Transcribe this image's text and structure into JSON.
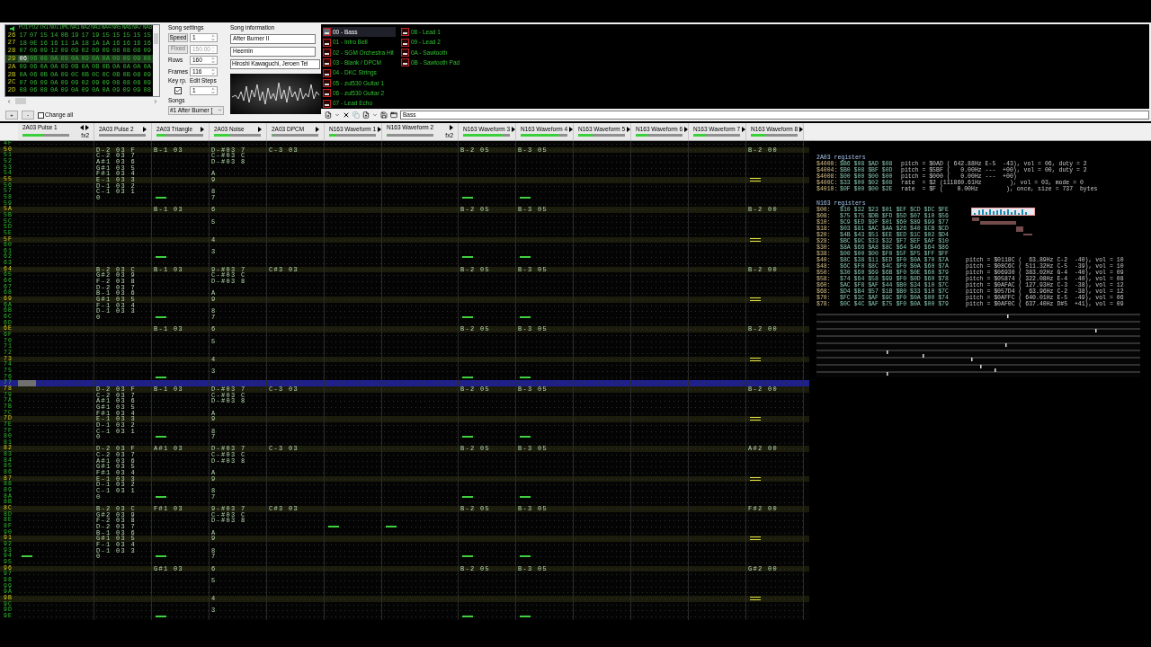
{
  "frames": {
    "columns": [
      "PU1",
      "PU2",
      "TRI",
      "NOI",
      "DMC",
      "NA1",
      "NA2",
      "NA3",
      "NA4",
      "NA5",
      "NA6",
      "NA7",
      "NA8"
    ],
    "rows": [
      {
        "label": "26",
        "selected": false,
        "values": [
          "17",
          "07",
          "15",
          "14",
          "0B",
          "19",
          "17",
          "19",
          "15",
          "15",
          "15",
          "15",
          "15"
        ]
      },
      {
        "label": "27",
        "selected": false,
        "values": [
          "18",
          "0E",
          "16",
          "16",
          "11",
          "1A",
          "18",
          "1A",
          "1A",
          "16",
          "16",
          "16",
          "16"
        ]
      },
      {
        "label": "28",
        "selected": false,
        "values": [
          "07",
          "06",
          "09",
          "12",
          "09",
          "09",
          "02",
          "09",
          "09",
          "08",
          "08",
          "08",
          "09"
        ]
      },
      {
        "label": "29",
        "selected": true,
        "values": [
          "06",
          "06",
          "08",
          "0A",
          "09",
          "0A",
          "09",
          "0A",
          "0A",
          "09",
          "09",
          "09",
          "08"
        ]
      },
      {
        "label": "2A",
        "selected": false,
        "values": [
          "09",
          "06",
          "0A",
          "0A",
          "09",
          "0B",
          "0A",
          "0B",
          "0B",
          "0A",
          "0A",
          "0A",
          "0A"
        ]
      },
      {
        "label": "2B",
        "selected": false,
        "values": [
          "0A",
          "06",
          "0B",
          "0A",
          "09",
          "0C",
          "0B",
          "0C",
          "0C",
          "0B",
          "0B",
          "08",
          "09"
        ]
      },
      {
        "label": "2C",
        "selected": false,
        "values": [
          "07",
          "06",
          "09",
          "0A",
          "09",
          "09",
          "02",
          "09",
          "09",
          "08",
          "08",
          "08",
          "09"
        ]
      },
      {
        "label": "2D",
        "selected": false,
        "values": [
          "08",
          "06",
          "08",
          "0A",
          "09",
          "0A",
          "09",
          "0A",
          "0A",
          "09",
          "09",
          "09",
          "08"
        ]
      }
    ]
  },
  "frame_controls": {
    "add": "+",
    "remove": "-",
    "change_all": {
      "label": "Change all",
      "checked": false
    }
  },
  "song_settings": {
    "title": "Song settings",
    "speed": {
      "label": "Speed",
      "value": "1"
    },
    "fixed": {
      "label": "Fixed",
      "value": "150.00",
      "disabled": true
    },
    "rows": {
      "label": "Rows",
      "value": "160"
    },
    "frames": {
      "label": "Frames",
      "value": "116"
    },
    "key_repeat": {
      "label": "Key rp.",
      "checked": true
    },
    "edit_steps": {
      "label": "Edit Steps",
      "value": "1"
    },
    "songs": {
      "label": "Songs",
      "value": "#1 After Burner ["
    }
  },
  "song_information": {
    "title": "Song information",
    "name": "After Burner II",
    "artist": "Heemin",
    "copyright": "Hiroshi Kawaguchi, Jeroen Tel"
  },
  "instruments": [
    {
      "label": "00 - Bass",
      "selected": true
    },
    {
      "label": "01 - Intro Bell",
      "selected": false
    },
    {
      "label": "02 - SGM Orchestra Hit",
      "selected": false
    },
    {
      "label": "03 - Blank / DPCM",
      "selected": false
    },
    {
      "label": "04 - DKC Strings",
      "selected": false
    },
    {
      "label": "05 - zul530 Guitar 1",
      "selected": false
    },
    {
      "label": "06 - zul530 Guitar 2",
      "selected": false
    },
    {
      "label": "07 - Lead Echo",
      "selected": false
    },
    {
      "label": "08 - Lead 1",
      "selected": false
    },
    {
      "label": "09 - Lead 2",
      "selected": false
    },
    {
      "label": "0A - Sawtooth",
      "selected": false
    },
    {
      "label": "0B - Sawtooth Pad",
      "selected": false
    }
  ],
  "instrument_name": "Bass",
  "channels": [
    {
      "name": "2A03 Pulse 1",
      "fx": "fx2",
      "left_arrow": true,
      "level": 0.45
    },
    {
      "name": "2A03 Pulse 2",
      "left_arrow": false,
      "level": 0
    },
    {
      "name": "2A03 Triangle",
      "left_arrow": false,
      "level": 0.2
    },
    {
      "name": "2A03 Noise",
      "left_arrow": false,
      "level": 0.35
    },
    {
      "name": "2A03 DPCM",
      "left_arrow": false,
      "level": 0
    },
    {
      "name": "N163 Waveform 1",
      "left_arrow": false,
      "level": 0.15
    },
    {
      "name": "N163 Waveform 2",
      "fx": "fx2",
      "left_arrow": false,
      "level": 0
    },
    {
      "name": "N163 Waveform 3",
      "left_arrow": false,
      "level": 0.85
    },
    {
      "name": "N163 Waveform 4",
      "left_arrow": false,
      "level": 0.8
    },
    {
      "name": "N163 Waveform 5",
      "left_arrow": false,
      "level": 0.3
    },
    {
      "name": "N163 Waveform 6",
      "left_arrow": false,
      "level": 0.25
    },
    {
      "name": "N163 Waveform 7",
      "left_arrow": false,
      "level": 0.25
    },
    {
      "name": "N163 Waveform 8",
      "left_arrow": false,
      "level": 0.3
    }
  ],
  "pattern": {
    "rows": [
      {
        "label": "4F",
        "highlighted": false,
        "selected": false
      },
      {
        "label": "50",
        "highlighted": true,
        "selected": false,
        "cells": [
          null,
          "D-2 03 F",
          "B-1 03",
          "D-#03 7",
          "C-3 03",
          null,
          null,
          "B-2 05",
          "B-3 05",
          null,
          null,
          null,
          "B-2 00"
        ]
      },
      {
        "label": "51",
        "highlighted": false,
        "selected": false,
        "cells": [
          null,
          "C-2 03 7",
          null,
          "C-#03 C",
          null,
          null,
          null,
          null,
          null,
          null,
          null,
          null,
          null
        ]
      },
      {
        "label": "52",
        "highlighted": false,
        "selected": false,
        "cells": [
          null,
          "A#1 03 6",
          null,
          "D-#03 8",
          null,
          null,
          null,
          null,
          null,
          null,
          null,
          null,
          null
        ]
      },
      {
        "label": "53",
        "highlighted": false,
        "selected": false,
        "cells": [
          null,
          "G#1 03 5",
          null,
          null,
          null,
          null,
          null,
          null,
          null,
          null,
          null,
          null,
          null
        ]
      },
      {
        "label": "54",
        "highlighted": false,
        "selected": false,
        "cells": [
          null,
          "F#1 03 4",
          null,
          "A",
          null,
          null,
          null,
          null,
          null,
          null,
          null,
          null,
          null
        ]
      },
      {
        "label": "55",
        "highlighted": true,
        "selected": false,
        "cells": [
          null,
          "E-1 03 3",
          null,
          "9",
          null,
          null,
          null,
          null,
          null,
          null,
          null,
          null,
          {
            "kind": "release"
          }
        ]
      },
      {
        "label": "56",
        "highlighted": false,
        "selected": false,
        "cells": [
          null,
          "D-1 03 2",
          null,
          null,
          null,
          null,
          null,
          null,
          null,
          null,
          null,
          null,
          null
        ]
      },
      {
        "label": "57",
        "highlighted": false,
        "selected": false,
        "cells": [
          null,
          "C-1 03 1",
          null,
          "8",
          null,
          null,
          null,
          null,
          null,
          null,
          null,
          null,
          null
        ]
      },
      {
        "label": "58",
        "highlighted": false,
        "selected": false,
        "cells": [
          null,
          "0",
          {
            "kind": "cut"
          },
          "7",
          null,
          null,
          null,
          {
            "kind": "cut"
          },
          {
            "kind": "cut"
          },
          null,
          null,
          null,
          null
        ]
      },
      {
        "label": "59",
        "highlighted": false,
        "selected": false
      },
      {
        "label": "5A",
        "highlighted": true,
        "selected": false,
        "cells": [
          null,
          null,
          "B-1 03",
          "6",
          null,
          null,
          null,
          "B-2 05",
          "B-3 05",
          null,
          null,
          null,
          "B-2 00"
        ]
      },
      {
        "label": "5B",
        "highlighted": false,
        "selected": false
      },
      {
        "label": "5C",
        "highlighted": false,
        "selected": false,
        "cells": [
          null,
          null,
          null,
          "5",
          null,
          null,
          null,
          null,
          null,
          null,
          null,
          null,
          null
        ]
      },
      {
        "label": "5D",
        "highlighted": false,
        "selected": false
      },
      {
        "label": "5E",
        "highlighted": false,
        "selected": false
      },
      {
        "label": "5F",
        "highlighted": true,
        "selected": false,
        "cells": [
          null,
          null,
          null,
          "4",
          null,
          null,
          null,
          null,
          null,
          null,
          null,
          null,
          {
            "kind": "release"
          }
        ]
      },
      {
        "label": "60",
        "highlighted": false,
        "selected": false
      },
      {
        "label": "61",
        "highlighted": false,
        "selected": false,
        "cells": [
          null,
          null,
          null,
          "3",
          null,
          null,
          null,
          null,
          null,
          null,
          null,
          null,
          null
        ]
      },
      {
        "label": "62",
        "highlighted": false,
        "selected": false,
        "cells": [
          null,
          null,
          {
            "kind": "cut"
          },
          null,
          null,
          null,
          null,
          {
            "kind": "cut"
          },
          {
            "kind": "cut"
          },
          null,
          null,
          null,
          null
        ]
      },
      {
        "label": "63",
        "highlighted": false,
        "selected": false
      },
      {
        "label": "64",
        "highlighted": true,
        "selected": false,
        "cells": [
          null,
          "B-2 03 C",
          "B-1 03",
          "9-#03 7",
          "C#3 03",
          null,
          null,
          "B-2 05",
          "B-3 05",
          null,
          null,
          null,
          "B-2 00"
        ]
      },
      {
        "label": "65",
        "highlighted": false,
        "selected": false,
        "cells": [
          null,
          "G#2 03 9",
          null,
          "C-#03 C",
          null,
          null,
          null,
          null,
          null,
          null,
          null,
          null,
          null
        ]
      },
      {
        "label": "66",
        "highlighted": false,
        "selected": false,
        "cells": [
          null,
          "F-2 03 8",
          null,
          "D-#03 8",
          null,
          null,
          null,
          null,
          null,
          null,
          null,
          null,
          null
        ]
      },
      {
        "label": "67",
        "highlighted": false,
        "selected": false,
        "cells": [
          null,
          "D-2 03 7",
          null,
          null,
          null,
          null,
          null,
          null,
          null,
          null,
          null,
          null,
          null
        ]
      },
      {
        "label": "68",
        "highlighted": false,
        "selected": false,
        "cells": [
          null,
          "B-1 03 6",
          null,
          "A",
          null,
          null,
          null,
          null,
          null,
          null,
          null,
          null,
          null
        ]
      },
      {
        "label": "69",
        "highlighted": true,
        "selected": false,
        "cells": [
          null,
          "G#1 03 5",
          null,
          "9",
          null,
          null,
          null,
          null,
          null,
          null,
          null,
          null,
          {
            "kind": "release"
          }
        ]
      },
      {
        "label": "6A",
        "highlighted": false,
        "selected": false,
        "cells": [
          null,
          "F-1 03 4",
          null,
          null,
          null,
          null,
          null,
          null,
          null,
          null,
          null,
          null,
          null
        ]
      },
      {
        "label": "6B",
        "highlighted": false,
        "selected": false,
        "cells": [
          null,
          "D-1 03 3",
          null,
          "8",
          null,
          null,
          null,
          null,
          null,
          null,
          null,
          null,
          null
        ]
      },
      {
        "label": "6C",
        "highlighted": false,
        "selected": false,
        "cells": [
          null,
          "0",
          {
            "kind": "cut"
          },
          "7",
          null,
          null,
          null,
          {
            "kind": "cut"
          },
          {
            "kind": "cut"
          },
          null,
          null,
          null,
          null
        ]
      },
      {
        "label": "6D",
        "highlighted": false,
        "selected": false
      },
      {
        "label": "6E",
        "highlighted": true,
        "selected": false,
        "cells": [
          null,
          null,
          "B-1 03",
          "6",
          null,
          null,
          null,
          "B-2 05",
          "B-3 05",
          null,
          null,
          null,
          "B-2 00"
        ]
      },
      {
        "label": "6F",
        "highlighted": false,
        "selected": false
      },
      {
        "label": "70",
        "highlighted": false,
        "selected": false,
        "cells": [
          null,
          null,
          null,
          "5",
          null,
          null,
          null,
          null,
          null,
          null,
          null,
          null,
          null
        ]
      },
      {
        "label": "71",
        "highlighted": false,
        "selected": false
      },
      {
        "label": "72",
        "highlighted": false,
        "selected": false
      },
      {
        "label": "73",
        "highlighted": true,
        "selected": false,
        "cells": [
          null,
          null,
          null,
          "4",
          null,
          null,
          null,
          null,
          null,
          null,
          null,
          null,
          {
            "kind": "release"
          }
        ]
      },
      {
        "label": "74",
        "highlighted": false,
        "selected": false
      },
      {
        "label": "75",
        "highlighted": false,
        "selected": false,
        "cells": [
          null,
          null,
          null,
          "3",
          null,
          null,
          null,
          null,
          null,
          null,
          null,
          null,
          null
        ]
      },
      {
        "label": "76",
        "highlighted": false,
        "selected": false,
        "cells": [
          null,
          null,
          {
            "kind": "cut"
          },
          null,
          null,
          null,
          null,
          {
            "kind": "cut"
          },
          {
            "kind": "cut"
          },
          null,
          null,
          null,
          null
        ]
      },
      {
        "label": "77",
        "highlighted": false,
        "selected": true
      },
      {
        "label": "78",
        "highlighted": true,
        "selected": false,
        "cells": [
          null,
          "D-2 03 F",
          "B-1 03",
          "D-#03 7",
          "C-3 03",
          null,
          null,
          "B-2 05",
          "B-3 05",
          null,
          null,
          null,
          "B-2 00"
        ]
      },
      {
        "label": "79",
        "highlighted": false,
        "selected": false,
        "cells": [
          null,
          "C-2 03 7",
          null,
          "C-#03 C",
          null,
          null,
          null,
          null,
          null,
          null,
          null,
          null,
          null
        ]
      },
      {
        "label": "7A",
        "highlighted": false,
        "selected": false,
        "cells": [
          null,
          "A#1 03 6",
          null,
          "D-#03 8",
          null,
          null,
          null,
          null,
          null,
          null,
          null,
          null,
          null
        ]
      },
      {
        "label": "7B",
        "highlighted": false,
        "selected": false,
        "cells": [
          null,
          "G#1 03 5",
          null,
          null,
          null,
          null,
          null,
          null,
          null,
          null,
          null,
          null,
          null
        ]
      },
      {
        "label": "7C",
        "highlighted": false,
        "selected": false,
        "cells": [
          null,
          "F#1 03 4",
          null,
          "A",
          null,
          null,
          null,
          null,
          null,
          null,
          null,
          null,
          null
        ]
      },
      {
        "label": "7D",
        "highlighted": true,
        "selected": false,
        "cells": [
          null,
          "E-1 03 3",
          null,
          "9",
          null,
          null,
          null,
          null,
          null,
          null,
          null,
          null,
          {
            "kind": "release"
          }
        ]
      },
      {
        "label": "7E",
        "highlighted": false,
        "selected": false,
        "cells": [
          null,
          "D-1 03 2",
          null,
          null,
          null,
          null,
          null,
          null,
          null,
          null,
          null,
          null,
          null
        ]
      },
      {
        "label": "7F",
        "highlighted": false,
        "selected": false,
        "cells": [
          null,
          "C-1 03 1",
          null,
          "8",
          null,
          null,
          null,
          null,
          null,
          null,
          null,
          null,
          null
        ]
      },
      {
        "label": "80",
        "highlighted": false,
        "selected": false,
        "cells": [
          null,
          "0",
          {
            "kind": "cut"
          },
          "7",
          null,
          null,
          null,
          {
            "kind": "cut"
          },
          {
            "kind": "cut"
          },
          null,
          null,
          null,
          null
        ]
      },
      {
        "label": "81",
        "highlighted": false,
        "selected": false
      },
      {
        "label": "82",
        "highlighted": true,
        "selected": false,
        "cells": [
          null,
          "D-2 03 F",
          "A#1 03",
          "D-#03 7",
          "C-3 03",
          null,
          null,
          "B-2 05",
          "B-3 05",
          null,
          null,
          null,
          "A#2 00"
        ]
      },
      {
        "label": "83",
        "highlighted": false,
        "selected": false,
        "cells": [
          null,
          "C-2 03 7",
          null,
          "C-#03 C",
          null,
          null,
          null,
          null,
          null,
          null,
          null,
          null,
          null
        ]
      },
      {
        "label": "84",
        "highlighted": false,
        "selected": false,
        "cells": [
          null,
          "A#1 03 6",
          null,
          "D-#03 8",
          null,
          null,
          null,
          null,
          null,
          null,
          null,
          null,
          null
        ]
      },
      {
        "label": "85",
        "highlighted": false,
        "selected": false,
        "cells": [
          null,
          "G#1 03 5",
          null,
          null,
          null,
          null,
          null,
          null,
          null,
          null,
          null,
          null,
          null
        ]
      },
      {
        "label": "86",
        "highlighted": false,
        "selected": false,
        "cells": [
          null,
          "F#1 03 4",
          null,
          "A",
          null,
          null,
          null,
          null,
          null,
          null,
          null,
          null,
          null
        ]
      },
      {
        "label": "87",
        "highlighted": true,
        "selected": false,
        "cells": [
          null,
          "E-1 03 3",
          null,
          "9",
          null,
          null,
          null,
          null,
          null,
          null,
          null,
          null,
          {
            "kind": "release"
          }
        ]
      },
      {
        "label": "88",
        "highlighted": false,
        "selected": false,
        "cells": [
          null,
          "D-1 03 2",
          null,
          null,
          null,
          null,
          null,
          null,
          null,
          null,
          null,
          null,
          null
        ]
      },
      {
        "label": "89",
        "highlighted": false,
        "selected": false,
        "cells": [
          null,
          "C-1 03 1",
          null,
          "8",
          null,
          null,
          null,
          null,
          null,
          null,
          null,
          null,
          null
        ]
      },
      {
        "label": "8A",
        "highlighted": false,
        "selected": false,
        "cells": [
          null,
          "0",
          {
            "kind": "cut"
          },
          "7",
          null,
          null,
          null,
          {
            "kind": "cut"
          },
          {
            "kind": "cut"
          },
          null,
          null,
          null,
          null
        ]
      },
      {
        "label": "8B",
        "highlighted": false,
        "selected": false
      },
      {
        "label": "8C",
        "highlighted": true,
        "selected": false,
        "cells": [
          null,
          "B-2 03 C",
          "F#1 03",
          "9-#03 7",
          "C#3 03",
          null,
          null,
          "B-2 05",
          "B-3 05",
          null,
          null,
          null,
          "F#2 00"
        ]
      },
      {
        "label": "8D",
        "highlighted": false,
        "selected": false,
        "cells": [
          null,
          "G#2 03 9",
          null,
          "C-#03 C",
          null,
          null,
          null,
          null,
          null,
          null,
          null,
          null,
          null
        ]
      },
      {
        "label": "8E",
        "highlighted": false,
        "selected": false,
        "cells": [
          null,
          "F-2 03 8",
          null,
          "D-#03 8",
          null,
          null,
          null,
          null,
          null,
          null,
          null,
          null,
          null
        ]
      },
      {
        "label": "8F",
        "highlighted": false,
        "selected": false,
        "cells": [
          null,
          "D-2 03 7",
          null,
          null,
          null,
          {
            "kind": "cut"
          },
          {
            "kind": "cut"
          },
          null,
          null,
          null,
          null,
          null,
          null
        ]
      },
      {
        "label": "90",
        "highlighted": false,
        "selected": false,
        "cells": [
          null,
          "B-1 03 6",
          null,
          "A",
          null,
          null,
          null,
          null,
          null,
          null,
          null,
          null,
          null
        ]
      },
      {
        "label": "91",
        "highlighted": true,
        "selected": false,
        "cells": [
          null,
          "G#1 03 5",
          null,
          "9",
          null,
          null,
          null,
          null,
          null,
          null,
          null,
          null,
          {
            "kind": "release"
          }
        ]
      },
      {
        "label": "92",
        "highlighted": false,
        "selected": false,
        "cells": [
          null,
          "F-1 03 4",
          null,
          null,
          null,
          null,
          null,
          null,
          null,
          null,
          null,
          null,
          null
        ]
      },
      {
        "label": "93",
        "highlighted": false,
        "selected": false,
        "cells": [
          null,
          "D-1 03 3",
          null,
          "8",
          null,
          null,
          null,
          null,
          null,
          null,
          null,
          null,
          null
        ]
      },
      {
        "label": "94",
        "highlighted": false,
        "selected": false,
        "cells": [
          {
            "kind": "cut"
          },
          "0",
          {
            "kind": "cut"
          },
          "7",
          null,
          null,
          null,
          {
            "kind": "cut"
          },
          {
            "kind": "cut"
          },
          null,
          null,
          null,
          null
        ]
      },
      {
        "label": "95",
        "highlighted": false,
        "selected": false
      },
      {
        "label": "96",
        "highlighted": true,
        "selected": false,
        "cells": [
          null,
          null,
          "G#1 03",
          "6",
          null,
          null,
          null,
          "B-2 05",
          "B-3 05",
          null,
          null,
          null,
          "G#2 00"
        ]
      },
      {
        "label": "97",
        "highlighted": false,
        "selected": false
      },
      {
        "label": "98",
        "highlighted": false,
        "selected": false,
        "cells": [
          null,
          null,
          null,
          "5",
          null,
          null,
          null,
          null,
          null,
          null,
          null,
          null,
          null
        ]
      },
      {
        "label": "99",
        "highlighted": false,
        "selected": false
      },
      {
        "label": "9A",
        "highlighted": false,
        "selected": false
      },
      {
        "label": "9B",
        "highlighted": true,
        "selected": false,
        "cells": [
          null,
          null,
          null,
          "4",
          null,
          null,
          null,
          null,
          null,
          null,
          null,
          null,
          {
            "kind": "release"
          }
        ]
      },
      {
        "label": "9C",
        "highlighted": false,
        "selected": false
      },
      {
        "label": "9D",
        "highlighted": false,
        "selected": false,
        "cells": [
          null,
          null,
          null,
          "3",
          null,
          null,
          null,
          null,
          null,
          null,
          null,
          null,
          null
        ]
      },
      {
        "label": "9E",
        "highlighted": false,
        "selected": false,
        "cells": [
          null,
          null,
          {
            "kind": "cut"
          },
          null,
          null,
          null,
          null,
          {
            "kind": "cut"
          },
          {
            "kind": "cut"
          },
          null,
          null,
          null,
          null
        ]
      }
    ]
  },
  "registers": {
    "title_2a03": "2A03 registers",
    "lines_2a03": [
      {
        "address": "$4000:",
        "bytes": "$B6 $08 $AD $08",
        "info": "pitch = $0AD ( 642.88Hz E-5  -43), vol = 06, duty = 2"
      },
      {
        "address": "$4004:",
        "bytes": "$B0 $08 $BF $0D",
        "info": "pitch = $5BF (   0.00Hz ---  +00), vol = 00, duty = 2"
      },
      {
        "address": "$4008:",
        "bytes": "$00 $00 $00 $00",
        "info": "pitch = $000 (   0.00Hz ---  +00)"
      },
      {
        "address": "$400C:",
        "bytes": "$33 $00 $02 $08",
        "info": "rate  = $2 (111860.61Hz        ), vol = 03, mode = 0"
      },
      {
        "address": "$4010:",
        "bytes": "$0F $00 $00 $2E",
        "info": "rate  = $F (    0.00Hz        ), once, size = 737  bytes"
      }
    ],
    "title_n163": "N163 registers",
    "lines_n163": [
      {
        "address": "$00:",
        "bytes": "$10 $32 $23 $01 $EF $CD $DC $FE"
      },
      {
        "address": "$08:",
        "bytes": "$75 $75 $DB $FD $5D $07 $10 $56"
      },
      {
        "address": "$10:",
        "bytes": "$C9 $ED $9F $01 $60 $89 $99 $77"
      },
      {
        "address": "$18:",
        "bytes": "$03 $81 $AC $AA $26 $40 $CB $CD"
      },
      {
        "address": "$20:",
        "bytes": "$4B $43 $51 $EE $ED $1C $02 $D4"
      },
      {
        "address": "$28:",
        "bytes": "$BC $9C $33 $32 $F7 $EF $AF $10"
      },
      {
        "address": "$30:",
        "bytes": "$8A $66 $A8 $8C $64 $46 $64 $86"
      },
      {
        "address": "$38:",
        "bytes": "$00 $00 $00 $F0 $5F $F5 $FF $FF"
      },
      {
        "address": "$40:",
        "bytes": "$8C $38 $11 $ED $F0 $0A $70 $7A",
        "info": "pitch = $0118C (  63.89Hz C-2  -40), vol = 10"
      },
      {
        "address": "$48:",
        "bytes": "$6C $F0 $8C $4C $F0 $0A $60 $7A",
        "info": "pitch = $08C6C ( 511.32Hz C-5  -39), vol = 10"
      },
      {
        "address": "$50:",
        "bytes": "$30 $60 $69 $6B $F0 $0E $60 $79",
        "info": "pitch = $06930 ( 383.02Hz G-4  -40), vol = 09"
      },
      {
        "address": "$58:",
        "bytes": "$74 $64 $58 $99 $F0 $0D $60 $78",
        "info": "pitch = $05874 ( 322.08Hz E-4  -40), vol = 08"
      },
      {
        "address": "$60:",
        "bytes": "$AC $F8 $AF $44 $B0 $34 $10 $7C",
        "info": "pitch = $0AFAC ( 127.93Hz C-3  -38), vol = 12"
      },
      {
        "address": "$68:",
        "bytes": "$D4 $B4 $57 $1B $B0 $33 $10 $7C",
        "info": "pitch = $057D4 (  63.96Hz C-2  -38), vol = 12"
      },
      {
        "address": "$70:",
        "bytes": "$FC $3C $AF $9C $F0 $0A $00 $74",
        "info": "pitch = $0AFFC ( 640.01Hz E-5  -49), vol = 06"
      },
      {
        "address": "$78:",
        "bytes": "$0C $4C $AF $75 $F0 $0A $00 $79",
        "info": "pitch = $0AF0C ( 637.40Hz D#5  +41), vol = 09"
      }
    ]
  }
}
